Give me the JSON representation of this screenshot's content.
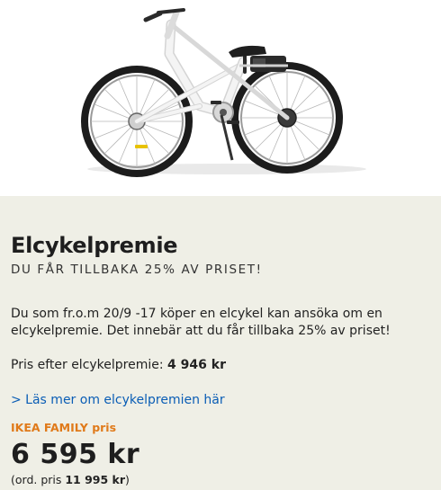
{
  "product": {
    "image_alt": "elcykel",
    "title": "Elcykelpremie",
    "subtitle": "DU FÅR TILLBAKA 25% AV PRISET!",
    "description": "Du som fr.o.m 20/9 -17 köper en elcykel kan ansöka om en elcykelpremie. Det innebär att du får tillbaka 25% av priset!",
    "after_premium_label": "Pris efter elcykelpremie:",
    "after_premium_value": "4 946 kr",
    "read_more_link": "> Läs mer om elcykelpremien här",
    "family_price_label": "IKEA FAMILY pris",
    "price": "6 595 kr",
    "ordinary_prefix": "(ord. pris",
    "ordinary_value": "11 995 kr",
    "ordinary_suffix": ")"
  },
  "colors": {
    "panel_background": "#efefe6",
    "link": "#0a5db5",
    "family_orange": "#e07a1a",
    "bike_frame": "#f2f2f2",
    "tire": "#1c1c1c"
  }
}
